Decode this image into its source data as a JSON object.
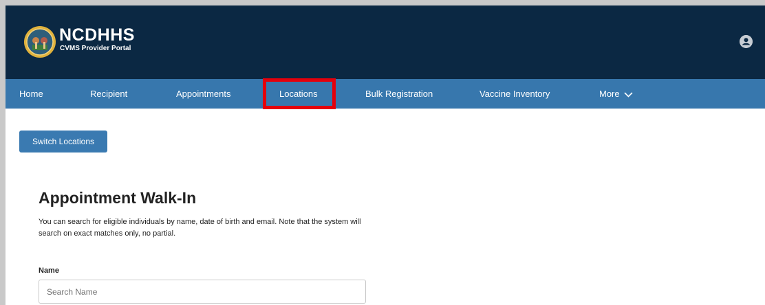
{
  "header": {
    "brand_title": "NCDHHS",
    "brand_subtitle": "CVMS Provider Portal",
    "logo_icon": "nc-state-seal-icon",
    "avatar_icon": "user-avatar-icon"
  },
  "nav": {
    "items": [
      {
        "label": "Home"
      },
      {
        "label": "Recipient"
      },
      {
        "label": "Appointments"
      },
      {
        "label": "Locations",
        "highlighted": true
      },
      {
        "label": "Bulk Registration"
      },
      {
        "label": "Vaccine Inventory"
      },
      {
        "label": "More",
        "icon": "chevron-down-icon"
      }
    ]
  },
  "main": {
    "switch_button_label": "Switch Locations",
    "title": "Appointment Walk-In",
    "description": "You can search for eligible individuals by name, date of birth and email. Note that the system will search on exact matches only, no partial.",
    "name_label": "Name",
    "name_placeholder": "Search Name"
  },
  "colors": {
    "header_bg": "#0b2843",
    "nav_bg": "#3777ad",
    "button_bg": "#3a7ab1",
    "highlight_border": "#e4000b"
  }
}
